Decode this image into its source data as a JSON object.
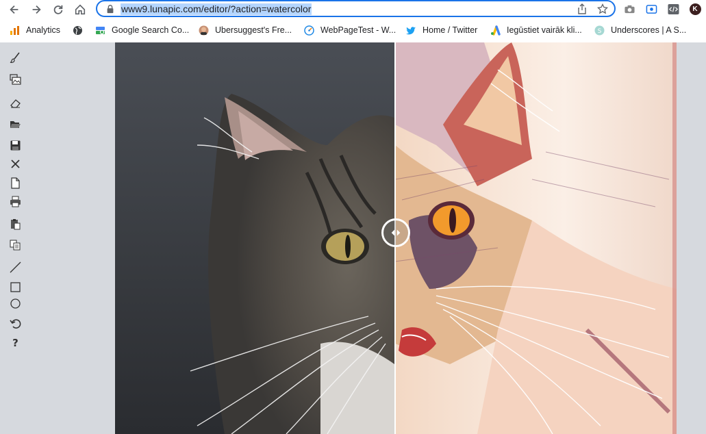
{
  "browser": {
    "url": "www9.lunapic.com/editor/?action=watercolor"
  },
  "bookmarks": [
    {
      "label": "Analytics",
      "icon": "analytics-icon"
    },
    {
      "label": "",
      "icon": "globe-icon"
    },
    {
      "label": "Google Search Co...",
      "icon": "search-console-icon"
    },
    {
      "label": "Ubersuggest's Fre...",
      "icon": "ubersuggest-icon"
    },
    {
      "label": "WebPageTest - W...",
      "icon": "webpagetest-icon"
    },
    {
      "label": "Home / Twitter",
      "icon": "twitter-icon"
    },
    {
      "label": "Iegūstiet vairāk kli...",
      "icon": "google-ads-icon"
    },
    {
      "label": "Underscores | A S...",
      "icon": "underscores-icon"
    }
  ],
  "profile": {
    "initial": "K"
  },
  "tools": [
    {
      "name": "brush-tool",
      "icon": "brush-icon"
    },
    {
      "name": "layers-tool",
      "icon": "layers-icon"
    },
    {
      "name": "eraser-tool",
      "icon": "eraser-icon"
    },
    {
      "name": "open-tool",
      "icon": "folder-open-icon"
    },
    {
      "name": "save-tool",
      "icon": "floppy-icon"
    },
    {
      "name": "close-tool",
      "icon": "close-icon"
    },
    {
      "name": "new-tool",
      "icon": "new-file-icon"
    },
    {
      "name": "print-tool",
      "icon": "printer-icon"
    },
    {
      "name": "paste-tool",
      "icon": "paste-icon"
    },
    {
      "name": "copy-tool",
      "icon": "copy-icon"
    },
    {
      "name": "line-tool",
      "icon": "line-icon"
    },
    {
      "name": "rectangle-tool",
      "icon": "rectangle-icon"
    },
    {
      "name": "circle-tool",
      "icon": "circle-icon"
    },
    {
      "name": "undo-tool",
      "icon": "undo-icon"
    },
    {
      "name": "help-tool",
      "icon": "help-icon"
    }
  ],
  "colors": {
    "accent": "#1a73e8",
    "selection": "#b4d5fe",
    "panel": "#d6d9de"
  }
}
